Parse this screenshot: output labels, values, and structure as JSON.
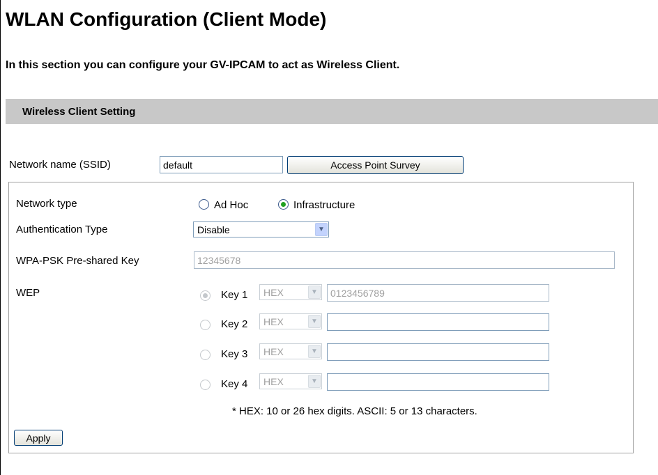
{
  "header": {
    "title": "WLAN Configuration (Client Mode)",
    "intro": "In this section you can configure your GV-IPCAM to act as Wireless Client."
  },
  "section": {
    "title": "Wireless Client Setting"
  },
  "ssid": {
    "label": "Network name (SSID)",
    "value": "default",
    "survey_button": "Access Point Survey"
  },
  "network_type": {
    "label": "Network type",
    "options": [
      "Ad Hoc",
      "Infrastructure"
    ],
    "selected": "Infrastructure"
  },
  "auth_type": {
    "label": "Authentication Type",
    "selected": "Disable"
  },
  "wpa": {
    "label": "WPA-PSK Pre-shared Key",
    "value": "12345678"
  },
  "wep": {
    "label": "WEP",
    "keys": [
      {
        "label": "Key 1",
        "format": "HEX",
        "value": "0123456789",
        "selected": true
      },
      {
        "label": "Key 2",
        "format": "HEX",
        "value": "",
        "selected": false
      },
      {
        "label": "Key 3",
        "format": "HEX",
        "value": "",
        "selected": false
      },
      {
        "label": "Key 4",
        "format": "HEX",
        "value": "",
        "selected": false
      }
    ],
    "hint": "* HEX: 10 or 26 hex digits. ASCII: 5 or 13 characters."
  },
  "apply_button": "Apply",
  "icons": {
    "dropdown": "chevron-down-icon",
    "radio": "radio-icon"
  }
}
